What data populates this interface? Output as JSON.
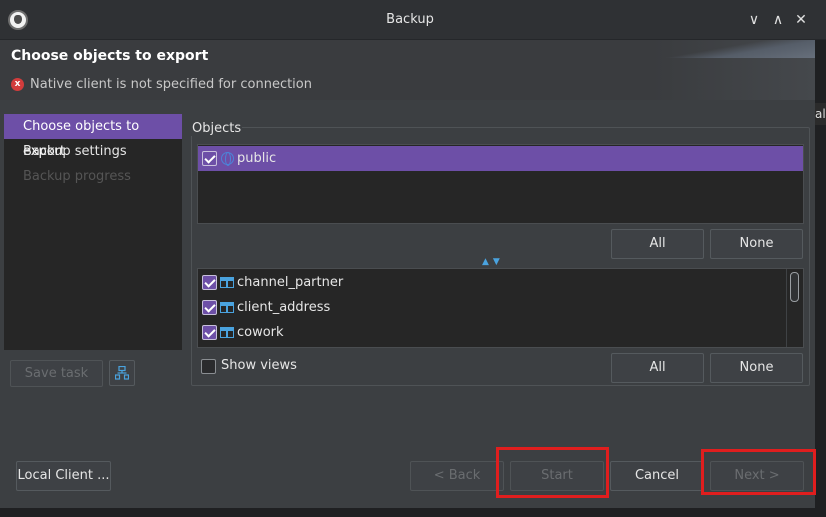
{
  "window": {
    "title": "Backup",
    "controls": {
      "minimize": "∨",
      "maximize": "∧",
      "close": "✕"
    }
  },
  "header": {
    "title": "Choose objects to export",
    "error_message": "Native client is not specified for connection",
    "error_icon": "x"
  },
  "background_fragment": "al",
  "nav": {
    "items": [
      {
        "label": "Choose objects to export",
        "state": "active"
      },
      {
        "label": "Backup settings",
        "state": "normal"
      },
      {
        "label": "Backup progress",
        "state": "disabled"
      }
    ]
  },
  "left_buttons": {
    "save_task": "Save task"
  },
  "objects": {
    "group_label": "Objects",
    "schemas": [
      {
        "name": "public",
        "checked": true,
        "selected": true
      }
    ],
    "schema_buttons": {
      "all": "All",
      "none": "None"
    },
    "tables": [
      {
        "name": "channel_partner",
        "checked": true
      },
      {
        "name": "client_address",
        "checked": true
      },
      {
        "name": "cowork",
        "checked": true
      }
    ],
    "table_buttons": {
      "all": "All",
      "none": "None"
    },
    "show_views": {
      "label": "Show views",
      "checked": false
    }
  },
  "footer": {
    "local_client": "Local Client ...",
    "back": "< Back",
    "start": "Start",
    "cancel": "Cancel",
    "next": "Next >"
  },
  "colors": {
    "accent": "#6d4fa7",
    "highlight": "#e01e1e",
    "icon_blue": "#4aa3df"
  }
}
